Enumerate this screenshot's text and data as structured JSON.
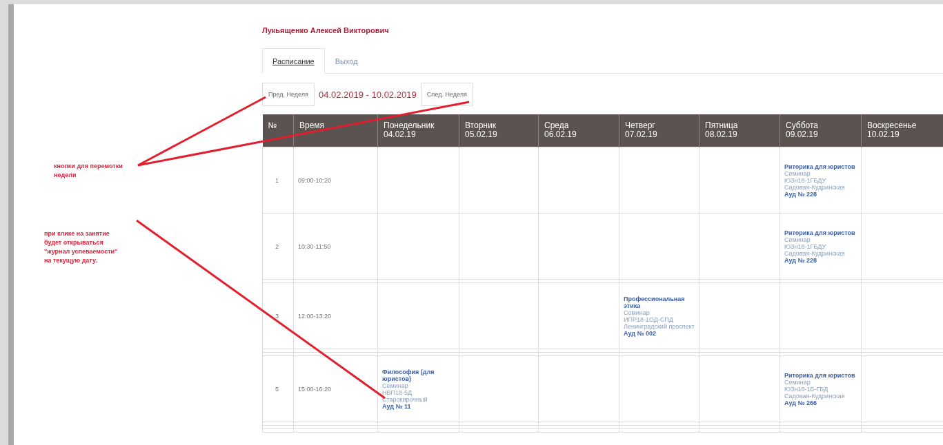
{
  "student_name": "Лукьященко Алексей Викторович",
  "tabs": [
    {
      "label": "Расписание",
      "selected": true
    },
    {
      "label": "Выход",
      "selected": false
    }
  ],
  "week_nav": {
    "prev_button": "Пред. Неделя",
    "range": "04.02.2019 - 10.02.2019",
    "next_button": "След. Неделя"
  },
  "annotations": [
    {
      "text": "кнопки для перемотки недели"
    },
    {
      "text": "при клике на занятие будет открываться \"журнал успеваемости\" на текущую дату."
    }
  ],
  "table": {
    "columns": [
      {
        "name": "№"
      },
      {
        "name": "Время"
      },
      {
        "name": "Понедельник",
        "date": "04.02.19"
      },
      {
        "name": "Вторник",
        "date": "05.02.19"
      },
      {
        "name": "Среда",
        "date": "06.02.19"
      },
      {
        "name": "Четверг",
        "date": "07.02.19"
      },
      {
        "name": "Пятница",
        "date": "08.02.19"
      },
      {
        "name": "Суббота",
        "date": "09.02.19"
      },
      {
        "name": "Воскресенье",
        "date": "10.02.19"
      }
    ],
    "rows": [
      {
        "kind": "lesson_row",
        "number": "1",
        "time": "09:00-10:20",
        "cells": [
          null,
          null,
          null,
          null,
          null,
          {
            "title": "Риторика для юристов",
            "type": "Семинар",
            "group": "ЮЗн18-1ГБДУ",
            "place": "Садовая-Кудринская",
            "room": "Ауд № 228"
          },
          null
        ]
      },
      {
        "kind": "lesson_row",
        "number": "2",
        "time": "10:30-11:50",
        "cells": [
          null,
          null,
          null,
          null,
          null,
          {
            "title": "Риторика для юристов",
            "type": "Семинар",
            "group": "ЮЗн18-1ГБДУ",
            "place": "Садовая-Кудринская",
            "room": "Ауд № 228"
          },
          null
        ]
      },
      {
        "kind": "spacer"
      },
      {
        "kind": "lesson_row",
        "number": "3",
        "time": "12:00-13:20",
        "cells": [
          null,
          null,
          null,
          {
            "title": "Профессиональная этика",
            "type": "Семинар",
            "group": "ИПР18-1ОД-СПД",
            "place": "Ленинградский проспект",
            "room": "Ауд № 002"
          },
          null,
          null,
          null
        ]
      },
      {
        "kind": "spacer"
      },
      {
        "kind": "spacer"
      },
      {
        "kind": "lesson_row",
        "number": "5",
        "time": "15:00-16:20",
        "cells": [
          {
            "title": "Философия (для юристов)",
            "type": "Семинар",
            "group": "НВП18-5Д",
            "place": "Старокирочный",
            "room": "Ауд № 11"
          },
          null,
          null,
          null,
          null,
          {
            "title": "Риторика для юристов",
            "type": "Семинар",
            "group": "ЮЗн18-1Б-ГБД",
            "place": "Садовая-Кудринская",
            "room": "Ауд № 266"
          },
          null
        ]
      },
      {
        "kind": "spacer"
      },
      {
        "kind": "spacer"
      },
      {
        "kind": "spacer"
      }
    ]
  }
}
